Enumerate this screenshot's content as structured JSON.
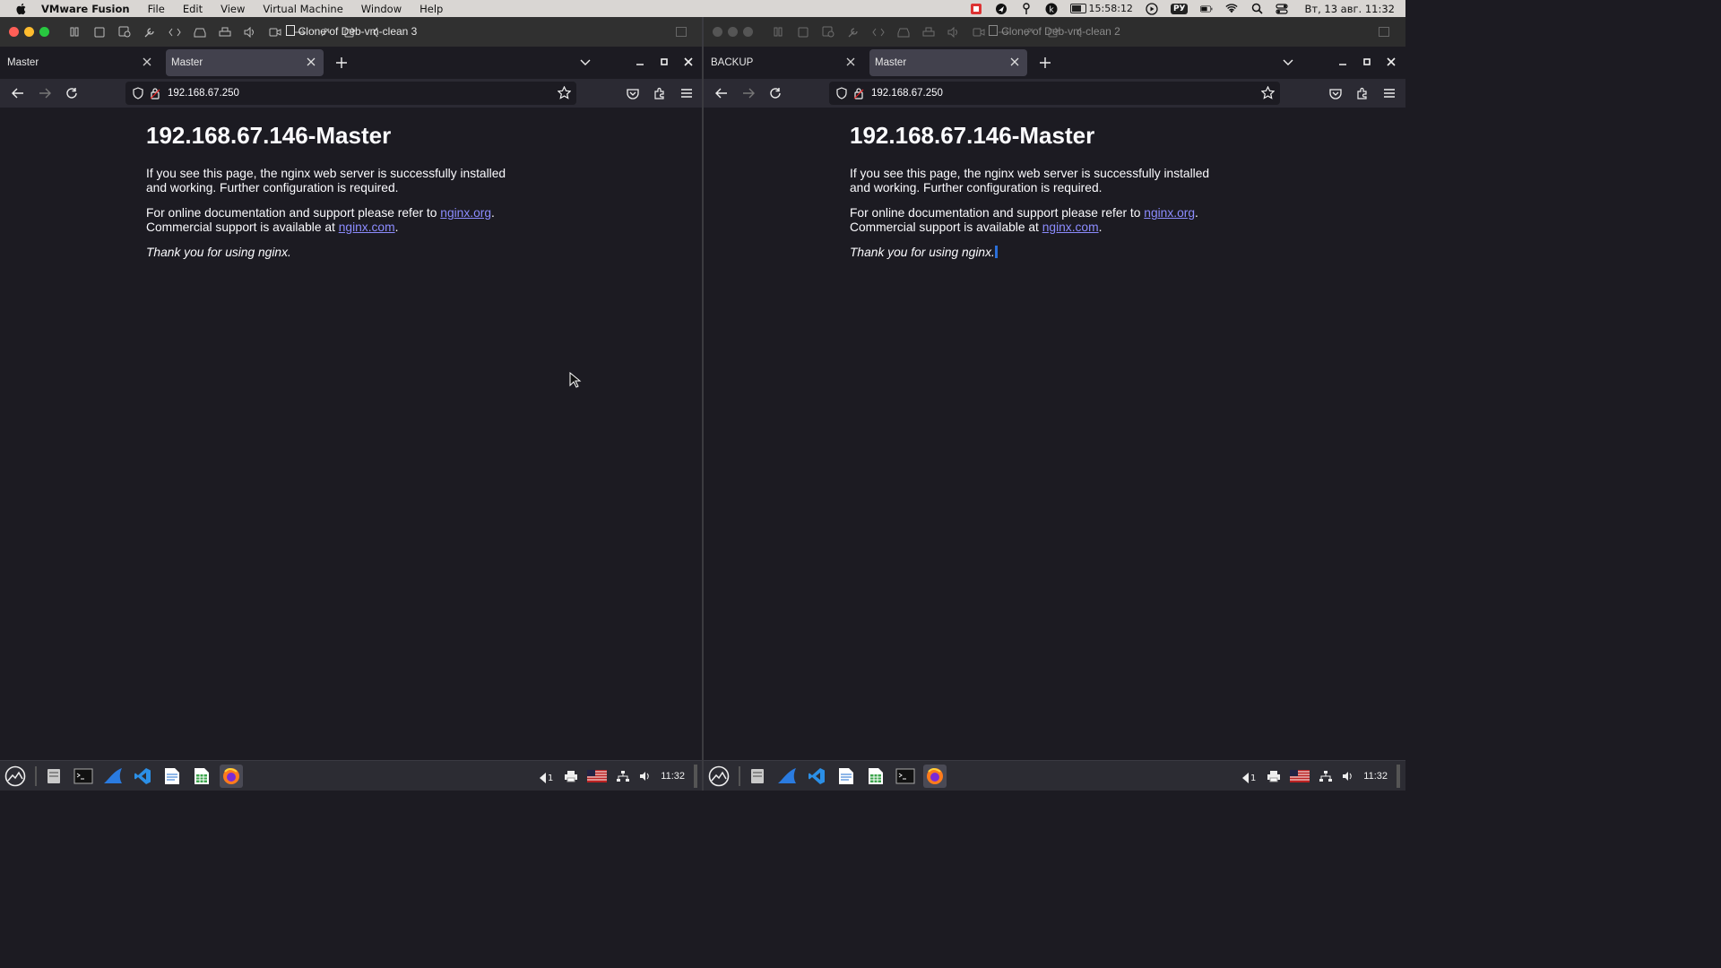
{
  "menubar": {
    "app_name": "VMware Fusion",
    "menus": [
      "File",
      "Edit",
      "View",
      "Virtual Machine",
      "Window",
      "Help"
    ],
    "battery_time": "15:58:12",
    "keyboard_layout": "РУ",
    "datetime": "Вт, 13 авг.  11:32"
  },
  "vm_left": {
    "window_title": "Clone of Deb-vm-clean 3",
    "tabs": [
      {
        "label": "Master",
        "active": false
      },
      {
        "label": "Master",
        "active": true
      }
    ],
    "url": "192.168.67.250",
    "page": {
      "heading": "192.168.67.146-Master",
      "p1": "If you see this page, the nginx web server is successfully installed and working. Further configuration is required.",
      "p2_text": "For online documentation and support please refer to ",
      "p2_link": "nginx.org",
      "p2_mid": "Commercial support is available at ",
      "p2_link2": "nginx.com",
      "p3": "Thank you for using nginx."
    },
    "clock": "11:32"
  },
  "vm_right": {
    "window_title": "Clone of Deb-vm-clean 2",
    "tabs": [
      {
        "label": "BACKUP",
        "active": false
      },
      {
        "label": "Master",
        "active": true
      }
    ],
    "url": "192.168.67.250",
    "page": {
      "heading": "192.168.67.146-Master",
      "p1": "If you see this page, the nginx web server is successfully installed and working. Further configuration is required.",
      "p2_text": "For online documentation and support please refer to ",
      "p2_link": "nginx.org",
      "p2_mid": "Commercial support is available at ",
      "p2_link2": "nginx.com",
      "p3": "Thank you for using nginx."
    },
    "clock": "11:32"
  },
  "punctuation": {
    "period": ".",
    "dot": "."
  },
  "colors": {
    "page_bg": "#1c1b22",
    "link": "#8c8cff",
    "menubar_bg": "#d9d6d3",
    "selection": "#2a6ed8"
  }
}
